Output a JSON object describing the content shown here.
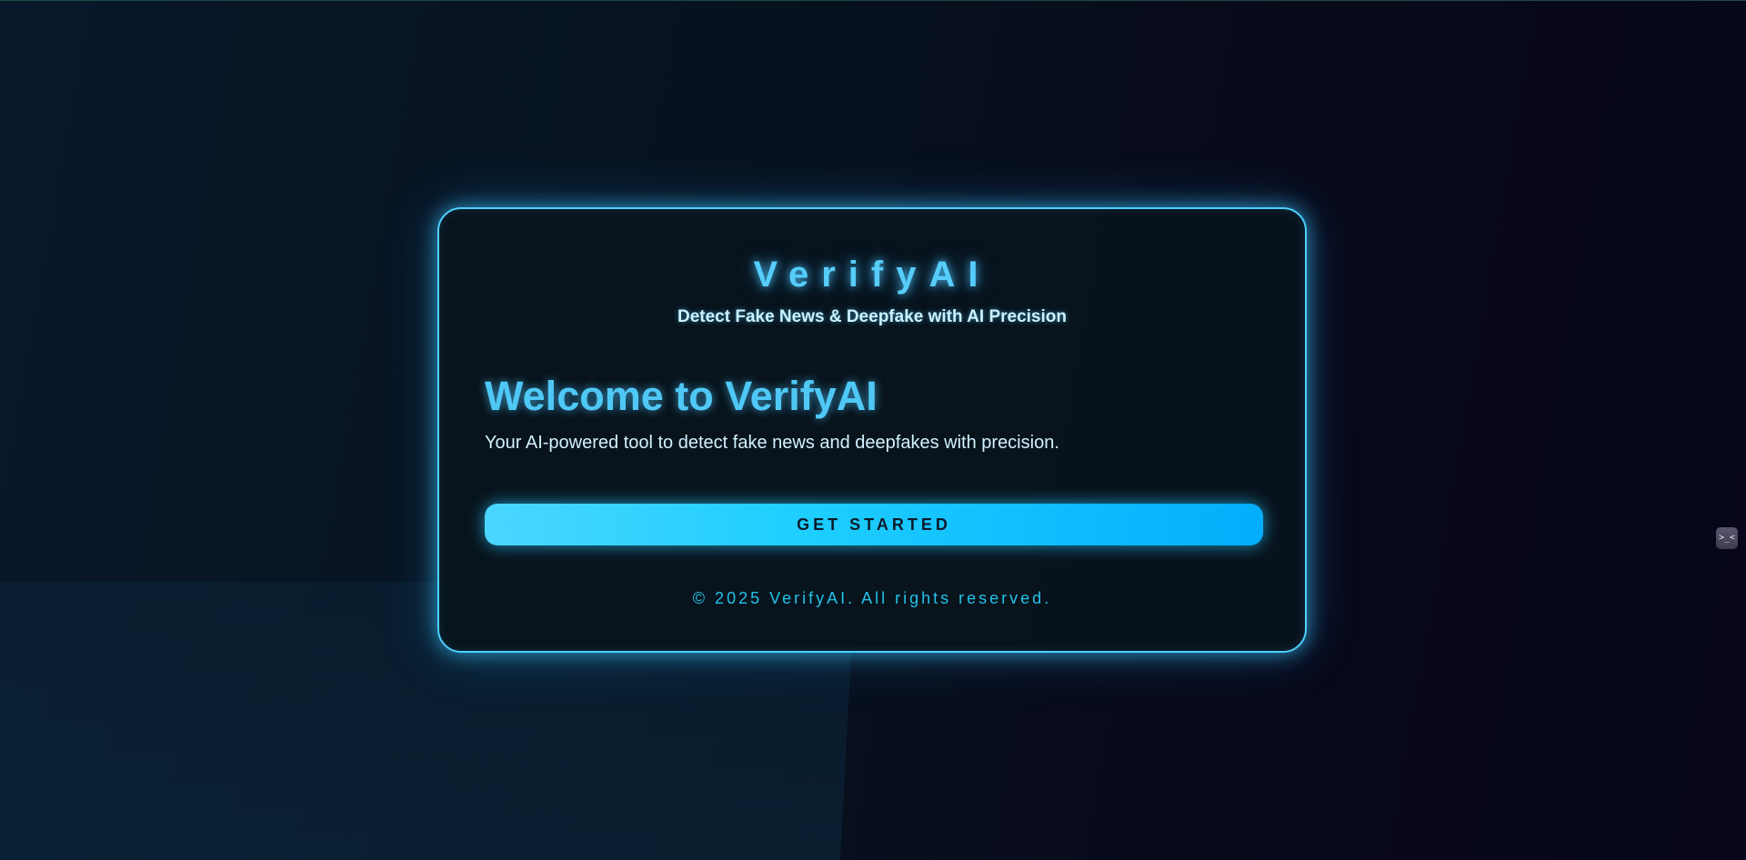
{
  "app": {
    "logo": "VerifyAI",
    "tagline": "Detect Fake News & Deepfake with AI Precision"
  },
  "main": {
    "heading": "Welcome to VerifyAI",
    "description": "Your AI-powered tool to detect fake news and deepfakes with precision.",
    "cta_label": "GET STARTED"
  },
  "footer": {
    "text": "© 2025 VerifyAI. All rights reserved."
  },
  "side_widget": {
    "icon": "terminal-icon",
    "glyph": ">_<"
  },
  "colors": {
    "accent": "#4fd0ff",
    "button_start": "#4ad6ff",
    "button_end": "#03aefc",
    "footer": "#23c2ea"
  }
}
